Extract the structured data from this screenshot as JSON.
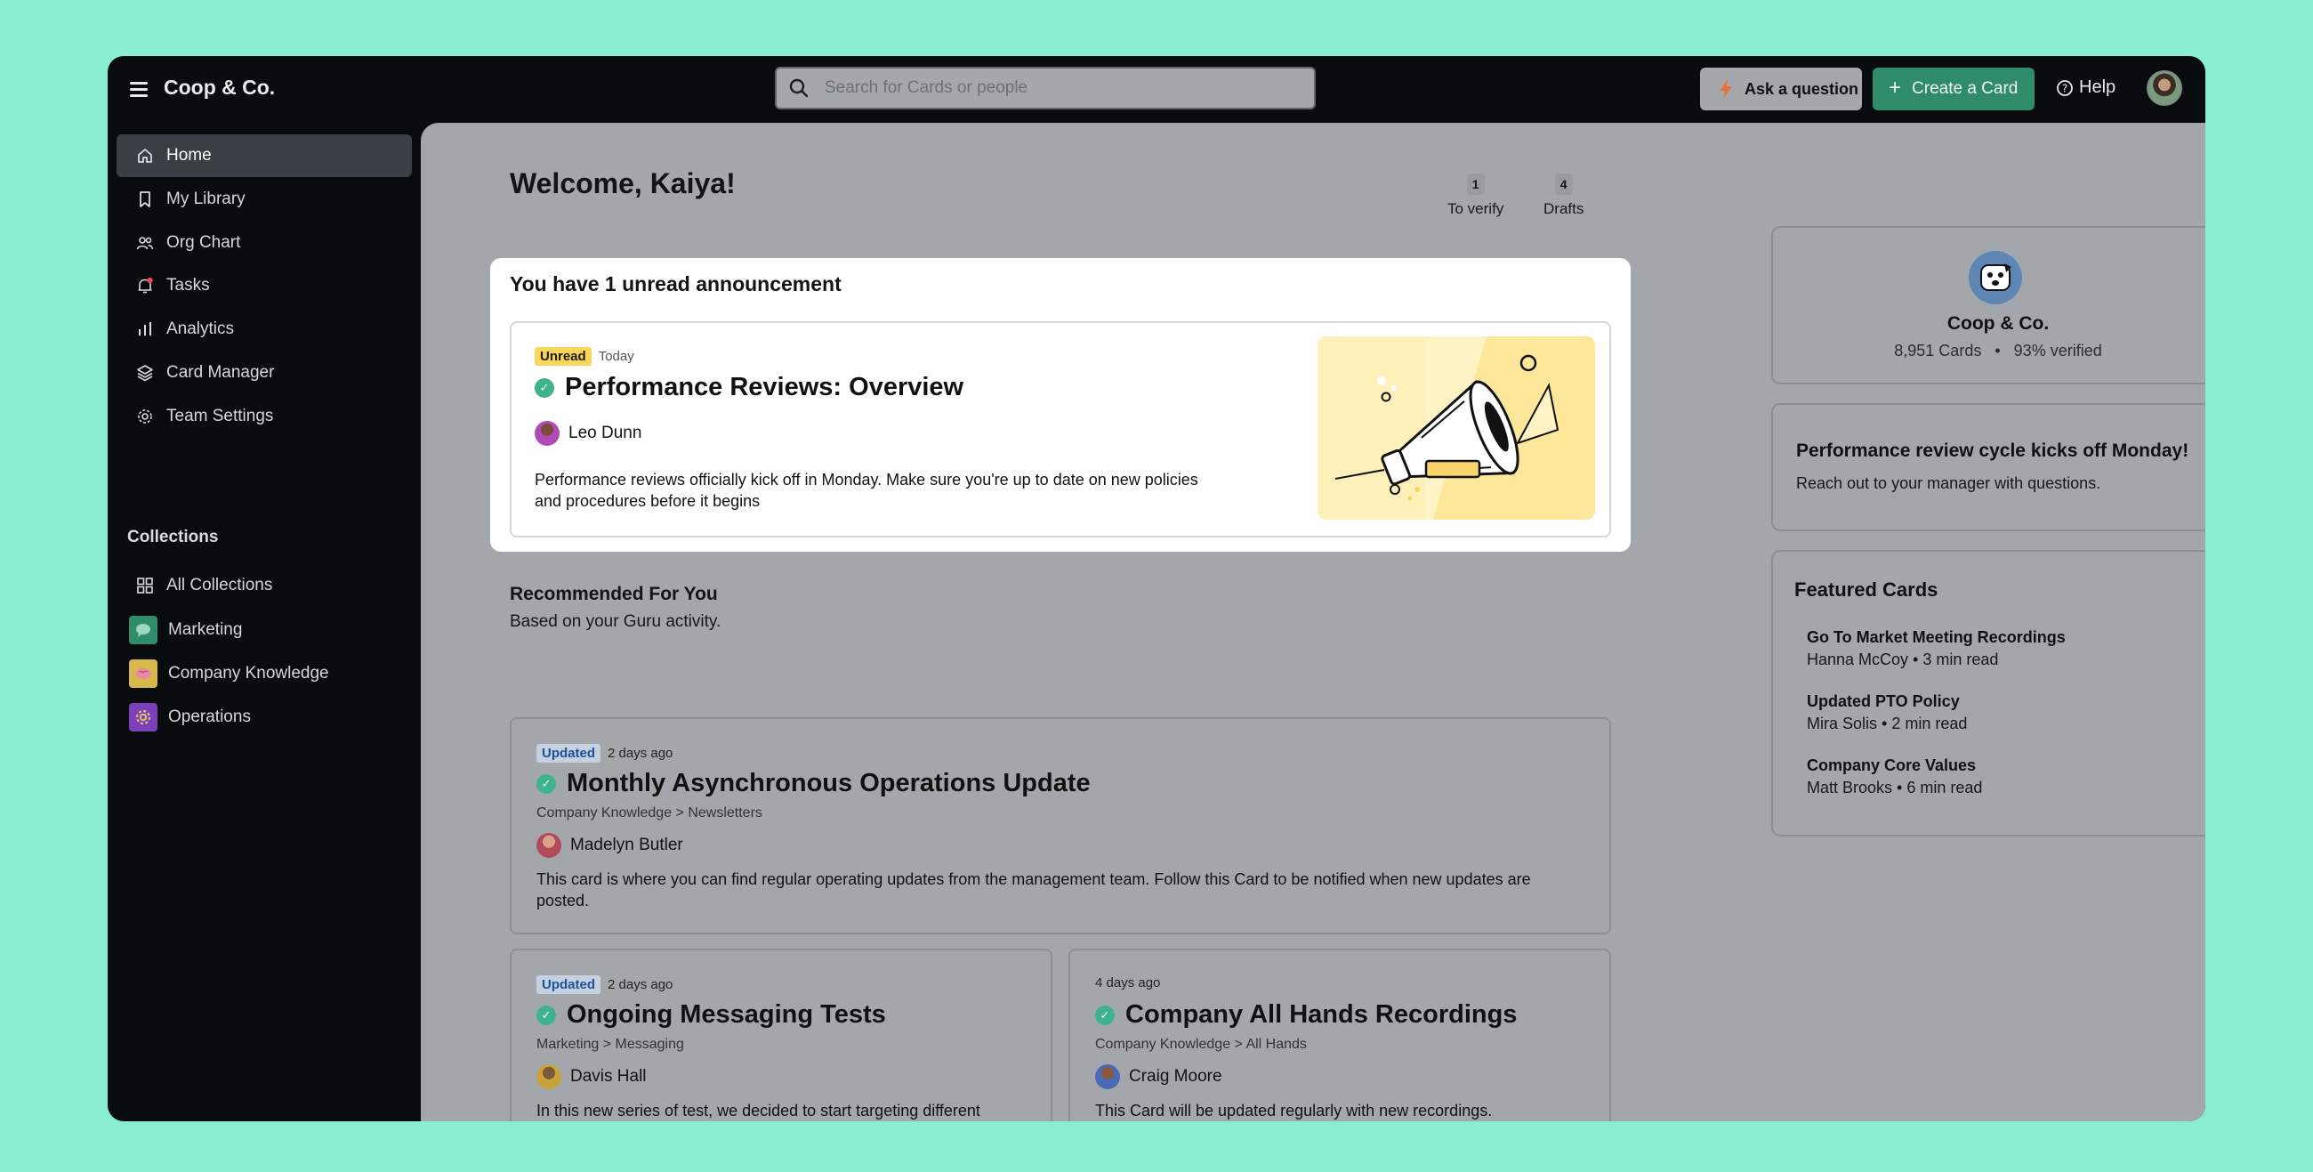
{
  "app": {
    "name": "Coop & Co."
  },
  "search": {
    "placeholder": "Search for Cards or people"
  },
  "header": {
    "ask_label": "Ask a question",
    "create_label": "Create a Card",
    "help_label": "Help"
  },
  "sidebar": {
    "items": [
      {
        "label": "Home",
        "icon": "home-icon"
      },
      {
        "label": "My Library",
        "icon": "bookmark-icon"
      },
      {
        "label": "Org Chart",
        "icon": "people-icon"
      },
      {
        "label": "Tasks",
        "icon": "bell-icon"
      },
      {
        "label": "Analytics",
        "icon": "bar-chart-icon"
      },
      {
        "label": "Card Manager",
        "icon": "layers-icon"
      },
      {
        "label": "Team Settings",
        "icon": "gear-icon"
      }
    ],
    "collections_heading": "Collections",
    "collections": [
      {
        "label": "All Collections",
        "icon": "grid-icon"
      },
      {
        "label": "Marketing",
        "icon": "chat-icon",
        "color": "#2f8c6b"
      },
      {
        "label": "Company Knowledge",
        "icon": "brain-icon",
        "color": "#d8b84a"
      },
      {
        "label": "Operations",
        "icon": "gear-icon",
        "color": "#7b3fb8"
      }
    ]
  },
  "welcome": {
    "title": "Welcome, Kaiya!",
    "stats": [
      {
        "count": "1",
        "label": "To verify"
      },
      {
        "count": "4",
        "label": "Drafts"
      }
    ]
  },
  "announcement": {
    "heading": "You have 1 unread announcement",
    "card": {
      "badge": "Unread",
      "time": "Today",
      "title": "Performance Reviews: Overview",
      "author": "Leo Dunn",
      "description": "Performance reviews officially kick off in Monday. Make sure you're up to date on new policies and procedures before it begins"
    }
  },
  "recommended": {
    "title": "Recommended For You",
    "subtitle": "Based on your Guru activity.",
    "cards": [
      {
        "badge": "Updated",
        "time": "2 days ago",
        "title": "Monthly Asynchronous Operations Update",
        "breadcrumb": "Company Knowledge > Newsletters",
        "author": "Madelyn Butler",
        "description": "This card is where you can find regular operating updates from the management team. Follow this Card to be notified when new updates are posted."
      },
      {
        "badge": "Updated",
        "time": "2 days ago",
        "title": "Ongoing Messaging Tests",
        "breadcrumb": "Marketing > Messaging",
        "author": "Davis Hall",
        "description": "In this new series of test, we decided to start targeting different key personas. Here are some results..."
      },
      {
        "badge": "",
        "time": "4 days ago",
        "title": "Company All Hands Recordings",
        "breadcrumb": "Company Knowledge > All Hands",
        "author": "Craig Moore",
        "description": "This Card will be updated regularly with new recordings."
      }
    ]
  },
  "org": {
    "name": "Coop & Co.",
    "cards": "8,951 Cards",
    "separator": "•",
    "verified": "93% verified"
  },
  "notice": {
    "title": "Performance review cycle kicks off Monday!",
    "body": "Reach out to your manager with questions."
  },
  "featured": {
    "heading": "Featured Cards",
    "items": [
      {
        "title": "Go To Market Meeting Recordings",
        "meta": "Hanna McCoy • 3 min read"
      },
      {
        "title": "Updated PTO Policy",
        "meta": "Mira Solis • 2 min read"
      },
      {
        "title": "Company Core Values",
        "meta": "Matt Brooks • 6 min read"
      }
    ]
  },
  "colors": {
    "accent": "#2f8c6b",
    "verified": "#3fb38d",
    "unread_badge": "#f8d75c",
    "background": "#89eecf"
  }
}
